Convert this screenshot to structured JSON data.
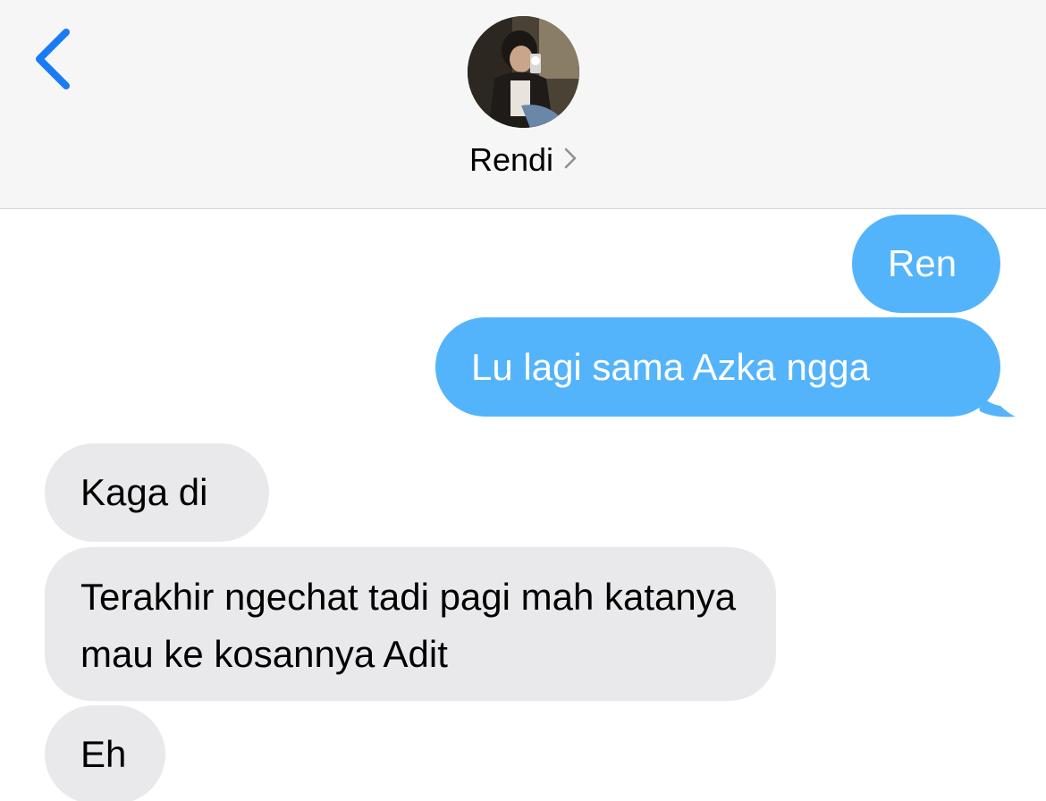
{
  "header": {
    "contact_name": "Rendi",
    "back_icon": "chevron-left-icon",
    "details_icon": "chevron-right-icon",
    "accent_color": "#1a7cf5"
  },
  "colors": {
    "sent_bubble": "#54b4fb",
    "received_bubble": "#e9e9eb"
  },
  "messages": [
    {
      "direction": "sent",
      "text": "Ren"
    },
    {
      "direction": "sent",
      "text": "Lu lagi sama Azka ngga"
    },
    {
      "direction": "received",
      "text": "Kaga di"
    },
    {
      "direction": "received",
      "text": "Terakhir ngechat tadi pagi mah katanya mau ke kosannya Adit"
    },
    {
      "direction": "received",
      "text": "Eh"
    }
  ]
}
